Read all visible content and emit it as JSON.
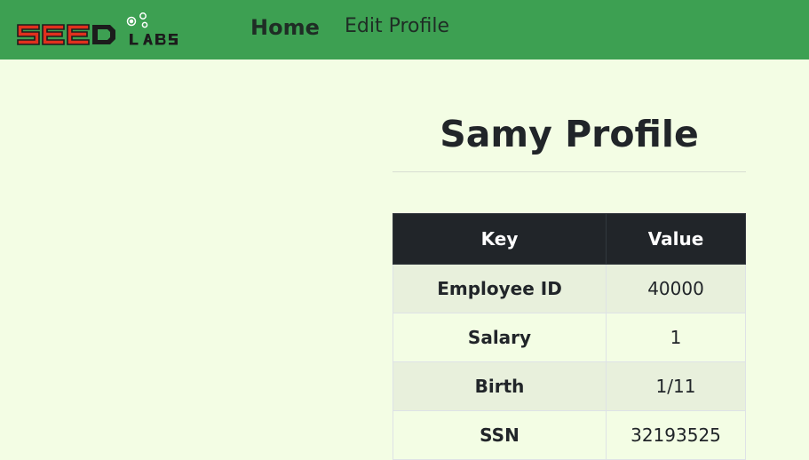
{
  "nav": {
    "logo_text": "SEEDLABS",
    "home_label": "Home",
    "edit_profile_label": "Edit Profile"
  },
  "profile": {
    "title": "Samy Profile",
    "columns": [
      "Key",
      "Value"
    ],
    "rows": [
      {
        "key": "Employee ID",
        "value": "40000"
      },
      {
        "key": "Salary",
        "value": "1"
      },
      {
        "key": "Birth",
        "value": "1/11"
      },
      {
        "key": "SSN",
        "value": "32193525"
      }
    ]
  },
  "colors": {
    "navbar": "#3da052",
    "background": "#f3fde4",
    "table_header": "#212529",
    "logo_red": "#e0301e"
  }
}
